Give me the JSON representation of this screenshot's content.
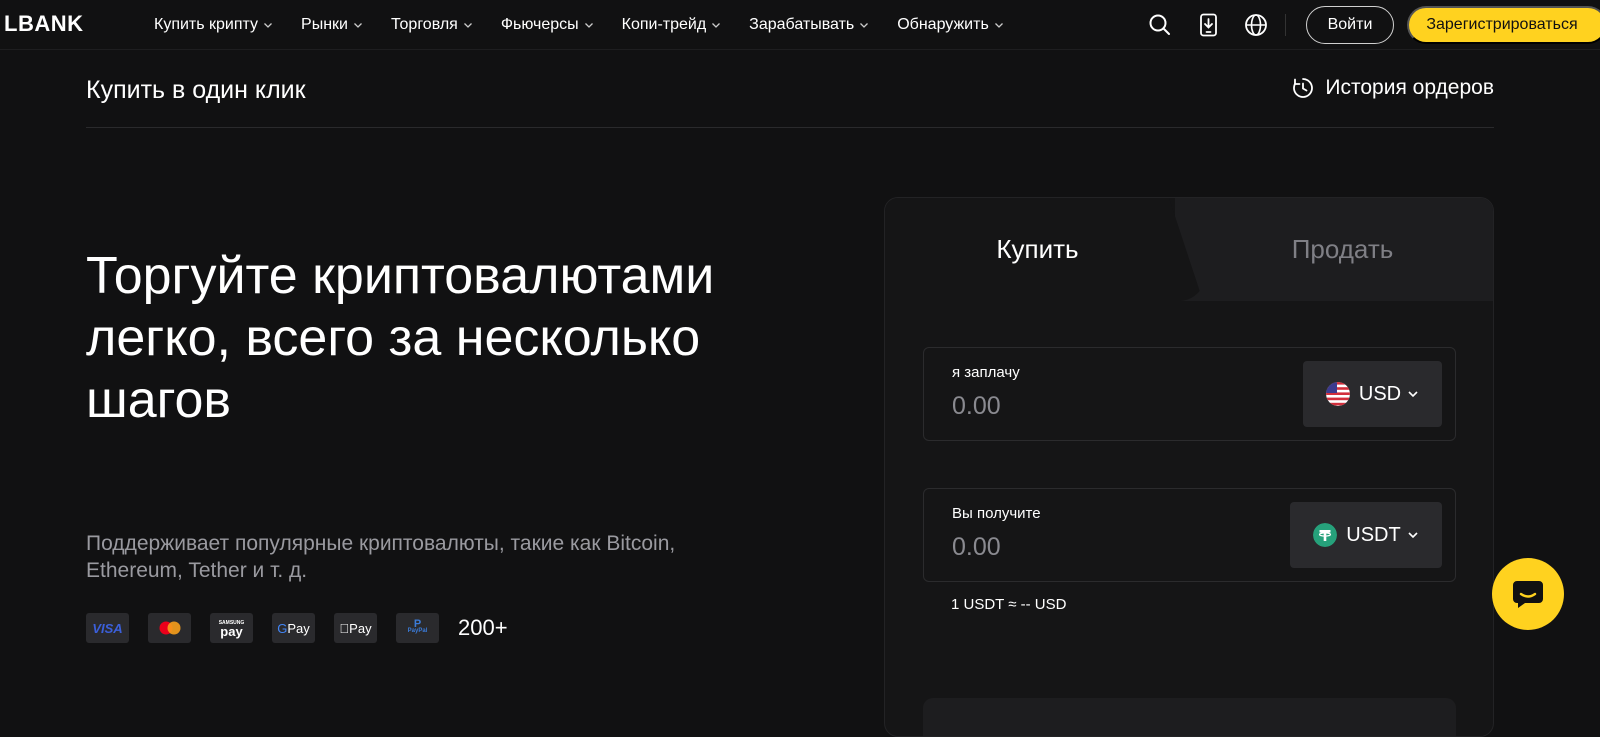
{
  "nav": {
    "logo": "LBANK",
    "menu": [
      {
        "label": "Купить крипту"
      },
      {
        "label": "Рынки"
      },
      {
        "label": "Торговля"
      },
      {
        "label": "Фьючерсы"
      },
      {
        "label": "Копи-трейд"
      },
      {
        "label": "Зарабатывать"
      },
      {
        "label": "Обнаружить"
      }
    ],
    "icons": [
      "search-icon",
      "download-app-icon",
      "globe-icon"
    ],
    "login_label": "Войти",
    "register_label": "Зарегистрироваться"
  },
  "page": {
    "title": "Купить в один клик",
    "history_label": "История ордеров"
  },
  "hero": {
    "headline": "Торгуйте криптовалютами легко, всего за несколько шагов",
    "subtitle": "Поддерживает популярные криптовалюты, такие как Bitcoin, Ethereum, Tether и т. д.",
    "payment_methods": [
      "VISA",
      "Mastercard",
      "Samsung Pay",
      "GPay",
      "Apple Pay",
      "PayPal"
    ],
    "more_label": "200+"
  },
  "trade": {
    "tab_buy": "Купить",
    "tab_sell": "Продать",
    "pay_label": "я заплачу",
    "pay_placeholder": "0.00",
    "pay_currency": "USD",
    "receive_label": "Вы получите",
    "receive_placeholder": "0.00",
    "receive_currency": "USDT",
    "rate": "1 USDT ≈ -- USD"
  },
  "colors": {
    "background": "#111112",
    "accent": "#ffd21f",
    "tether": "#26a17b"
  }
}
